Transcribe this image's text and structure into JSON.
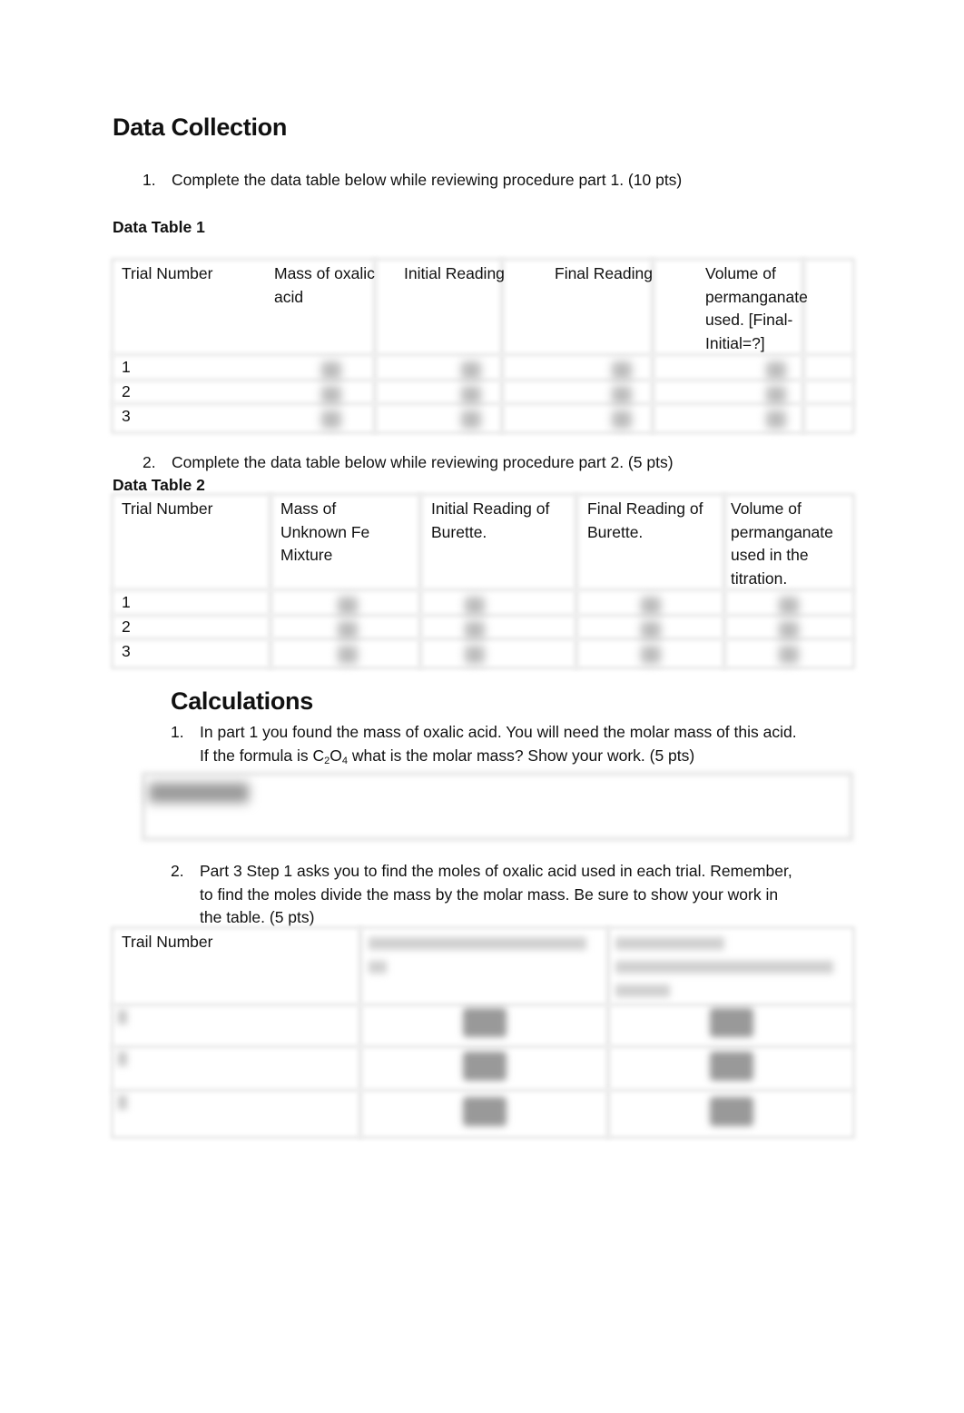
{
  "section1": {
    "title": "Data Collection",
    "q1": {
      "number": "1.",
      "text": "Complete the data table below while reviewing procedure part 1. (10 pts)"
    },
    "table1": {
      "title": "Data Table 1",
      "headers": [
        "Trial Number",
        "Mass of oxalic acid",
        "Initial Reading",
        "Final Reading",
        "Volume of permanganate used. [Final-Initial=?]"
      ],
      "rows": [
        "1",
        "2",
        "3"
      ],
      "values_note": "blurred"
    },
    "q2": {
      "number": "2.",
      "text": "Complete the data table below while reviewing procedure part 2. (5 pts)"
    },
    "table2": {
      "title": "Data Table 2",
      "headers": [
        "Trial Number",
        "Mass of Unknown Fe Mixture",
        "Initial Reading of Burette.",
        "Final Reading of Burette.",
        "Volume of permanganate used in the titration."
      ],
      "rows": [
        "1",
        "2",
        "3"
      ],
      "values_note": "blurred"
    }
  },
  "section2": {
    "title": "Calculations",
    "q1": {
      "number": "1.",
      "line1": "In part 1 you found the mass of oxalic acid. You will need the molar mass of this acid.",
      "line2_pre": "If the formula is C",
      "sub1": "2",
      "mid": "O",
      "sub2": "4",
      "line2_post": " what is the molar mass? Show your work. (5 pts)",
      "answer_note": "blurred"
    },
    "q2": {
      "number": "2.",
      "line1": "Part 3 Step 1 asks you to find the moles of oxalic acid used in each trial. Remember,",
      "line2": "to find the moles divide the mass by the molar mass. Be sure to show your work in",
      "line3": "the table. (5 pts)"
    },
    "table3": {
      "headers": [
        "Trail Number"
      ],
      "values_note": "blurred"
    }
  }
}
